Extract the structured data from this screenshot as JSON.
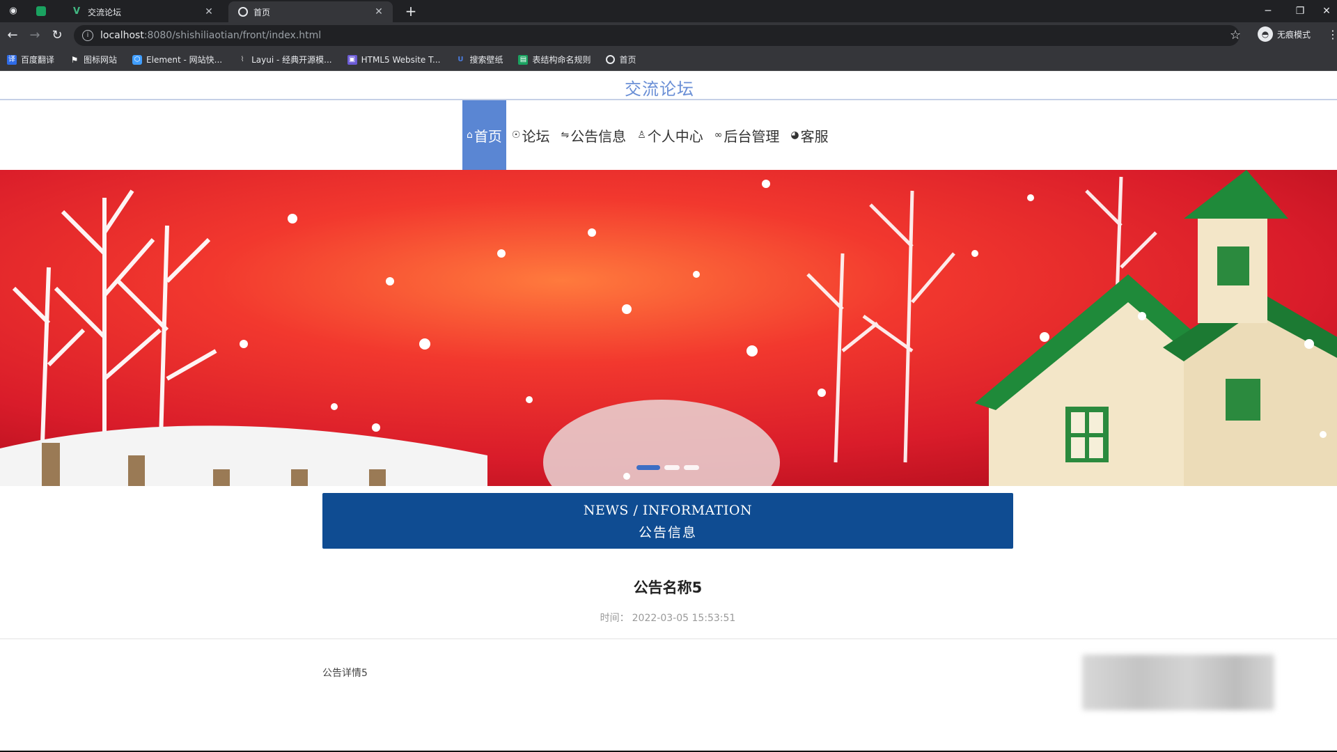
{
  "browser": {
    "tabs": [
      {
        "title": "交流论坛",
        "active": false,
        "icon": "vue-logo-icon"
      },
      {
        "title": "首页",
        "active": true,
        "icon": "globe-icon"
      }
    ],
    "url": {
      "host": "localhost",
      "path": ":8080/shishiliaotian/front/index.html"
    },
    "profile_label": "无痕模式",
    "bookmarks": [
      {
        "label": "百度翻译",
        "color": "#2e6be6"
      },
      {
        "label": "图标网站",
        "color": "#ffffff"
      },
      {
        "label": "Element - 网站快...",
        "color": "#409eff"
      },
      {
        "label": "Layui - 经典开源模...",
        "color": "#cccccc"
      },
      {
        "label": "HTML5 Website T...",
        "color": "#6b5bd6"
      },
      {
        "label": "搜索壁纸",
        "color": "#4a7de0"
      },
      {
        "label": "表结构命名规则",
        "color": "#1aa260"
      },
      {
        "label": "首页",
        "color": "#e8eaed"
      }
    ]
  },
  "site": {
    "title": "交流论坛",
    "menu": [
      {
        "label": "首页",
        "icon": "home-icon",
        "active": true
      },
      {
        "label": "论坛",
        "icon": "forum-icon",
        "active": false
      },
      {
        "label": "公告信息",
        "icon": "notice-icon",
        "active": false
      },
      {
        "label": "个人中心",
        "icon": "user-icon",
        "active": false
      },
      {
        "label": "后台管理",
        "icon": "link-icon",
        "active": false
      },
      {
        "label": "客服",
        "icon": "service-icon",
        "active": false
      }
    ]
  },
  "carousel": {
    "slide_count": 3,
    "active_index": 0
  },
  "news_header": {
    "en": "NEWS / INFORMATION",
    "cn": "公告信息"
  },
  "notice": {
    "title": "公告名称5",
    "time_label": "时间：",
    "time_value": "2022-03-05 15:53:51",
    "body": "公告详情5"
  },
  "colors": {
    "accent": "#5a86d3",
    "news_header_bg": "#0f4c92",
    "site_title": "#6a8fd6"
  }
}
